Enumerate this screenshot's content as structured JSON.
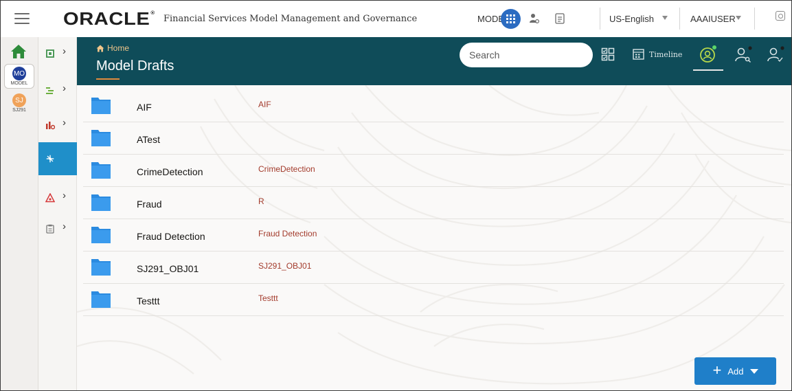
{
  "header": {
    "brand": "ORACLE",
    "brand_mark": "®",
    "product": "Financial Services Model Management and Governance",
    "module_label": "MODEL",
    "language": "US-English",
    "user": "AAAIUSER"
  },
  "left_rail": {
    "items": [
      {
        "initials": "MO",
        "label": "MODEL",
        "color": "#1f3f9a"
      },
      {
        "initials": "SJ",
        "label": "SJ291",
        "color": "#f0a259"
      }
    ]
  },
  "subnav": {
    "items": [
      {
        "icon": "model-icon",
        "has_chevron": true,
        "active": false
      },
      {
        "icon": "list-tree-icon",
        "has_chevron": true,
        "active": false
      },
      {
        "icon": "chart-settings-icon",
        "has_chevron": true,
        "active": false
      },
      {
        "icon": "network-icon",
        "has_chevron": false,
        "active": true
      },
      {
        "icon": "alert-triangle-icon",
        "has_chevron": true,
        "active": false
      },
      {
        "icon": "clipboard-icon",
        "has_chevron": true,
        "active": false
      }
    ]
  },
  "band": {
    "breadcrumb": "Home",
    "title": "Model Drafts",
    "search_placeholder": "Search",
    "timeline_label": "Timeline"
  },
  "folders": [
    {
      "name": "AIF",
      "description": "AIF"
    },
    {
      "name": "ATest",
      "description": ""
    },
    {
      "name": "CrimeDetection",
      "description": "CrimeDetection"
    },
    {
      "name": "Fraud",
      "description": "R"
    },
    {
      "name": "Fraud Detection",
      "description": "Fraud Detection"
    },
    {
      "name": "SJ291_OBJ01",
      "description": "SJ291_OBJ01"
    },
    {
      "name": "Testtt",
      "description": "Testtt"
    }
  ],
  "actions": {
    "add_label": "Add"
  },
  "colors": {
    "band": "#0f4c59",
    "accent_blue": "#1f7fc9",
    "description_text": "#a33b2c",
    "breadcrumb": "#f0c58a"
  }
}
